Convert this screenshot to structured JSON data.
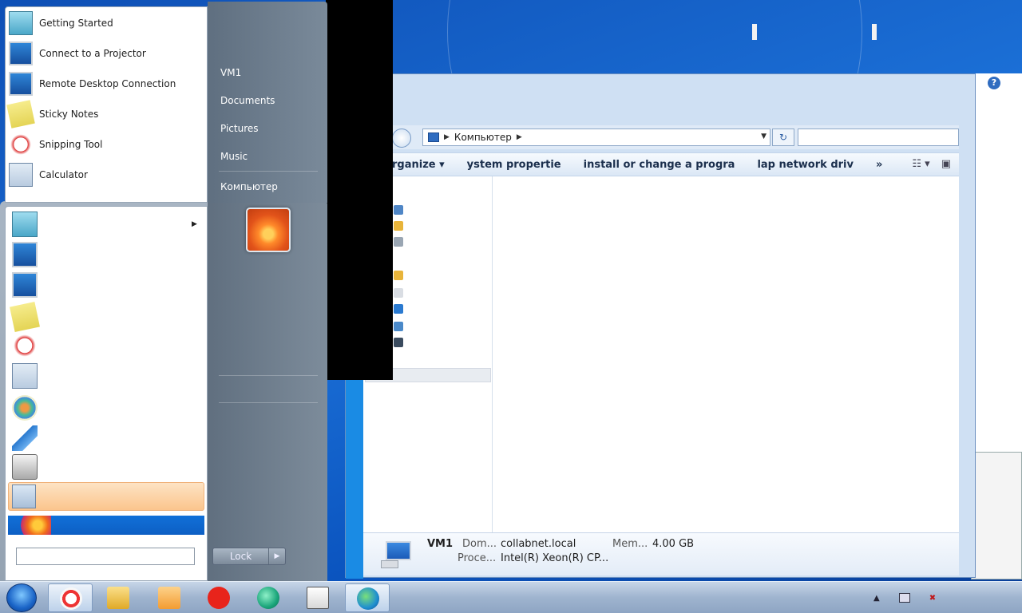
{
  "start_menu": {
    "pinned_items": [
      {
        "label": "Getting Started",
        "icon": "getting-started-icon"
      },
      {
        "label": "Connect to a Projector",
        "icon": "projector-icon"
      },
      {
        "label": "Remote Desktop Connection",
        "icon": "remote-desktop-icon"
      },
      {
        "label": "Sticky Notes",
        "icon": "sticky-notes-icon"
      },
      {
        "label": "Snipping Tool",
        "icon": "snipping-tool-icon"
      },
      {
        "label": "Calculator",
        "icon": "calculator-icon"
      }
    ],
    "right_links": [
      {
        "label": "VM1"
      },
      {
        "label": "Documents"
      },
      {
        "label": "Pictures"
      },
      {
        "label": "Music"
      },
      {
        "label": "Компьютер"
      }
    ],
    "lock_label": "Lock"
  },
  "explorer": {
    "address": "Компьютер",
    "commands": [
      "rganizе ▾",
      "ystem propertie",
      "install or change a progra",
      "lap network driv",
      "»"
    ],
    "details": {
      "name": "VM1",
      "domain_key": "Dom...",
      "domain_val": "collabnet.local",
      "memory_key": "Mem...",
      "memory_val": "4.00 GB",
      "processor_key": "Proce...",
      "processor_val": "Intel(R) Xeon(R) CP..."
    }
  },
  "taskbar": {
    "buttons": [
      "yandex-browser-icon",
      "file-explorer-icon",
      "media-player-icon",
      "yandex-icon",
      "browser-icon",
      "document-icon",
      "network-icon"
    ],
    "tray_arrow": "▲"
  }
}
